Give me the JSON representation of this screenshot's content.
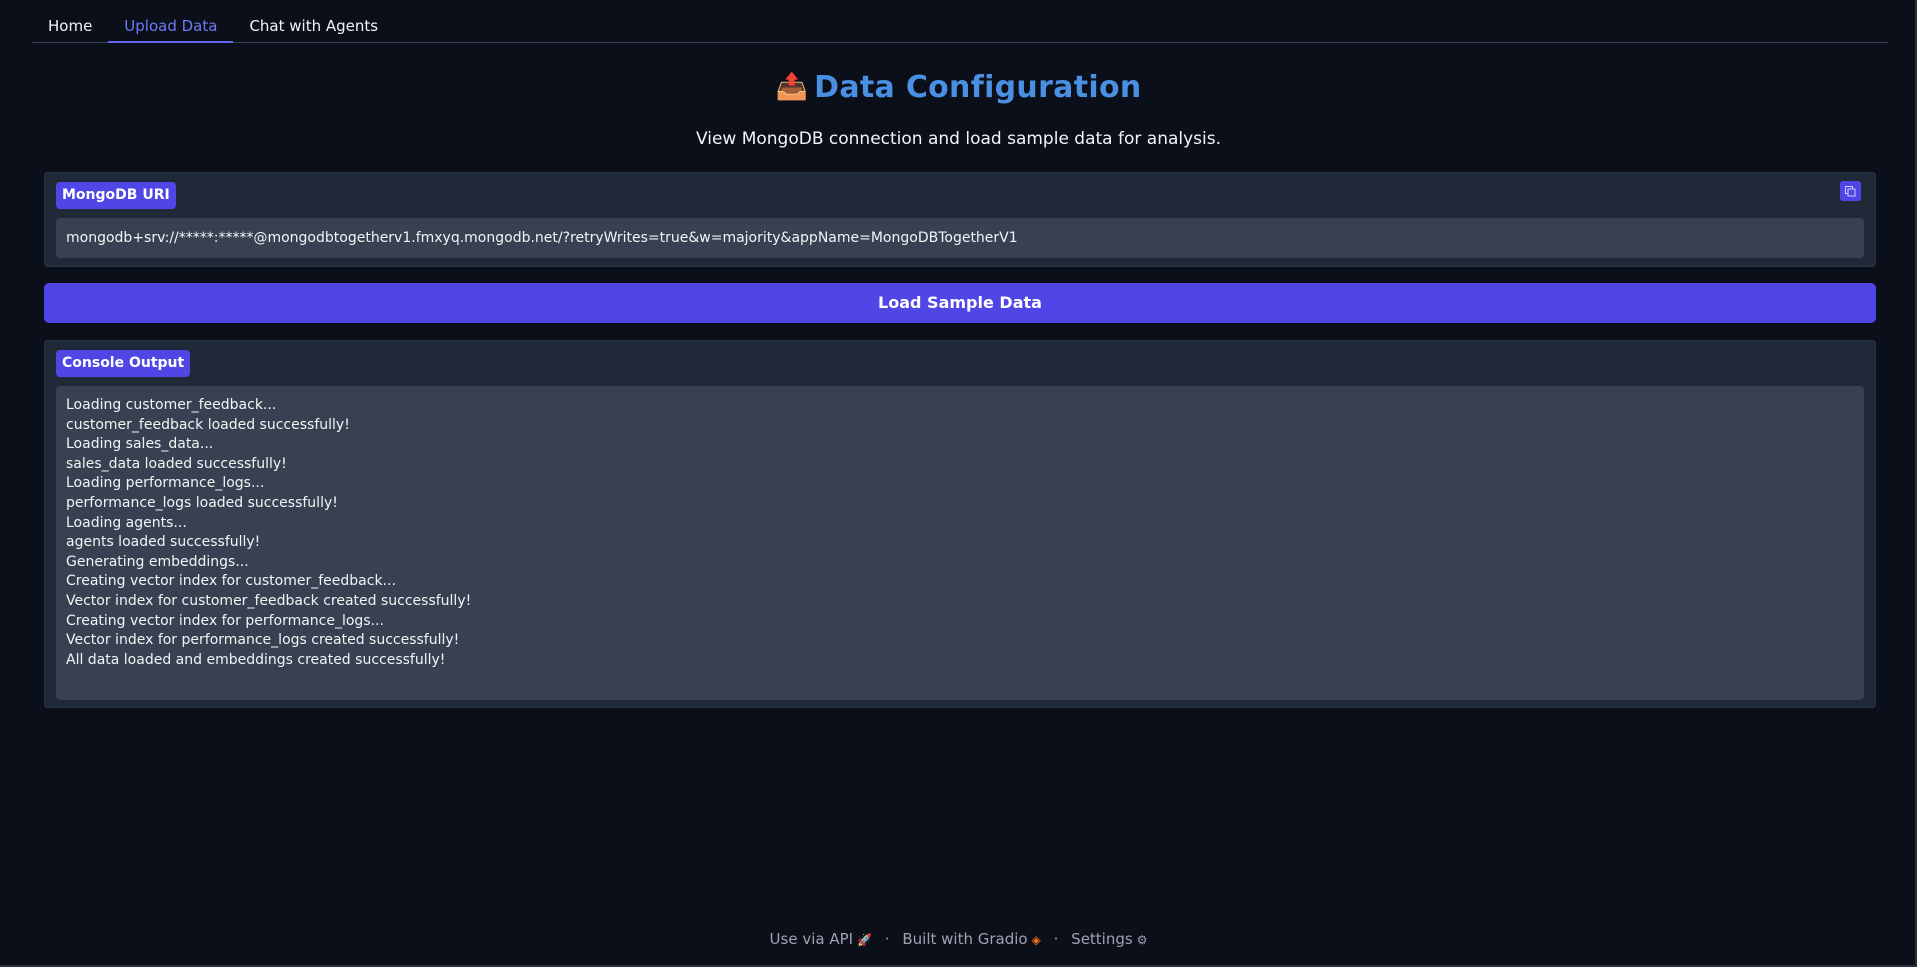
{
  "tabs": [
    {
      "label": "Home"
    },
    {
      "label": "Upload Data"
    },
    {
      "label": "Chat with Agents"
    }
  ],
  "header": {
    "emoji": "📤",
    "title": "Data Configuration",
    "subtitle": "View MongoDB connection and load sample data for analysis."
  },
  "uri_block": {
    "label": "MongoDB URI",
    "value": "mongodb+srv://*****:*****@mongodbtogetherv1.fmxyq.mongodb.net/?retryWrites=true&w=majority&appName=MongoDBTogetherV1"
  },
  "load_button": {
    "label": "Load Sample Data"
  },
  "console": {
    "label": "Console Output",
    "lines": [
      "Loading customer_feedback...",
      "customer_feedback loaded successfully!",
      "Loading sales_data...",
      "sales_data loaded successfully!",
      "Loading performance_logs...",
      "performance_logs loaded successfully!",
      "Loading agents...",
      "agents loaded successfully!",
      "Generating embeddings...",
      "Creating vector index for customer_feedback...",
      "Vector index for customer_feedback created successfully!",
      "Creating vector index for performance_logs...",
      "Vector index for performance_logs created successfully!",
      "All data loaded and embeddings created successfully!"
    ]
  },
  "footer": {
    "api": "Use via API",
    "built": "Built with Gradio",
    "settings": "Settings",
    "separator": "·"
  },
  "colors": {
    "accent": "#4f46e5",
    "title": "#4a90e2",
    "background": "#0b0f19"
  }
}
